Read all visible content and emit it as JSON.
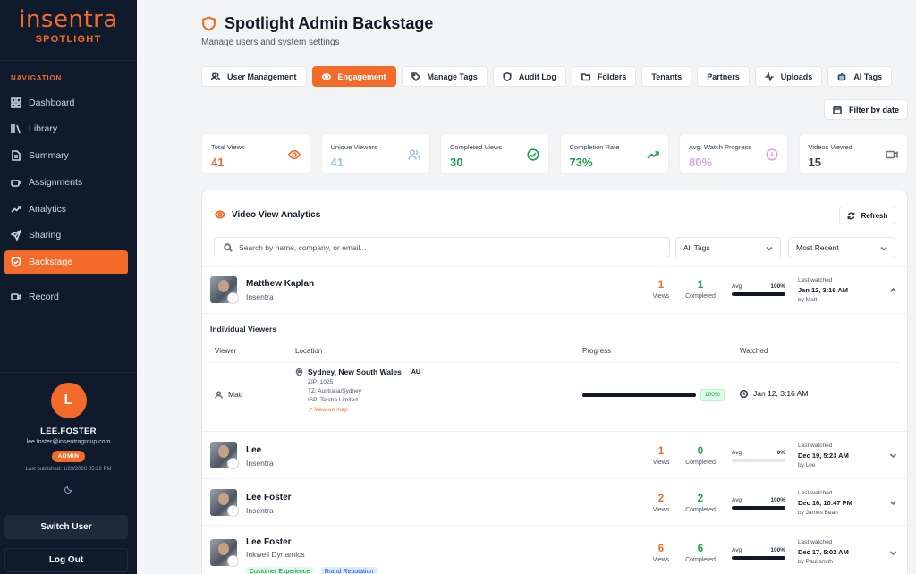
{
  "brand": {
    "name": "insentra",
    "product": "SPOTLIGHT"
  },
  "nav": {
    "label": "NAVIGATION",
    "items": [
      {
        "label": "Dashboard",
        "icon": "grid-icon"
      },
      {
        "label": "Library",
        "icon": "library-icon"
      },
      {
        "label": "Summary",
        "icon": "document-icon"
      },
      {
        "label": "Assignments",
        "icon": "coffee-icon"
      },
      {
        "label": "Analytics",
        "icon": "trend-icon"
      },
      {
        "label": "Sharing",
        "icon": "send-icon"
      },
      {
        "label": "Backstage",
        "icon": "shield-icon"
      },
      {
        "label": "Record",
        "icon": "video-icon"
      }
    ],
    "active": "Backstage"
  },
  "user": {
    "initial": "L",
    "name": "LEE.FOSTER",
    "email": "lee.foster@insentragroup.com",
    "role": "ADMIN",
    "last_published": "Last published: 1/29/2026 05:22 PM",
    "switch_label": "Switch User",
    "logout_label": "Log Out"
  },
  "header": {
    "title": "Spotlight Admin Backstage",
    "subtitle": "Manage users and system settings"
  },
  "tabs": [
    {
      "label": "User Management",
      "icon": "users-icon"
    },
    {
      "label": "Engagement",
      "icon": "eye-icon"
    },
    {
      "label": "Manage Tags",
      "icon": "tag-icon"
    },
    {
      "label": "Audit Log",
      "icon": "shield-icon"
    },
    {
      "label": "Folders",
      "icon": "folder-icon"
    },
    {
      "label": "Tenants",
      "icon": ""
    },
    {
      "label": "Partners",
      "icon": ""
    },
    {
      "label": "Uploads",
      "icon": "activity-icon"
    },
    {
      "label": "AI Tags",
      "icon": "robot-icon"
    }
  ],
  "active_tab": "Engagement",
  "filter_label": "Filter by date",
  "stats": [
    {
      "label": "Total Views",
      "value": "41",
      "color": "#f26b2a"
    },
    {
      "label": "Unique Viewers",
      "value": "41",
      "color": "#9cc3e0"
    },
    {
      "label": "Completed Views",
      "value": "30",
      "color": "#16a34a"
    },
    {
      "label": "Completion Rate",
      "value": "73%",
      "color": "#16a34a"
    },
    {
      "label": "Avg. Watch Progress",
      "value": "80%",
      "color": "#d8a6e8"
    },
    {
      "label": "Videos Viewed",
      "value": "15",
      "color": "#374151"
    }
  ],
  "panel": {
    "title": "Video View Analytics",
    "refresh_label": "Refresh",
    "search_placeholder": "Search by name, company, or email...",
    "tags_filter": "All Tags",
    "sort": "Most Recent",
    "views_label": "Views",
    "completed_label": "Completed",
    "avg_label": "Avg",
    "last_watched_label": "Last watched"
  },
  "rows": [
    {
      "name": "Matthew Kaplan",
      "company": "Insentra",
      "views": "1",
      "completed": "1",
      "avg": "100%",
      "avg_value": 100,
      "last_date": "Jan 12, 3:16 AM",
      "by": "by Matt",
      "expanded": true,
      "tags": []
    },
    {
      "name": "Lee",
      "company": "Insentra",
      "views": "1",
      "completed": "0",
      "avg": "0%",
      "avg_value": 0,
      "last_date": "Dec 19, 5:23 AM",
      "by": "by Lee",
      "expanded": false,
      "tags": []
    },
    {
      "name": "Lee Foster",
      "company": "Insentra",
      "views": "2",
      "completed": "2",
      "avg": "100%",
      "avg_value": 100,
      "last_date": "Dec 16, 10:47 PM",
      "by": "by James Bean",
      "expanded": false,
      "tags": []
    },
    {
      "name": "Lee Foster",
      "company": "Inkwell Dynamics",
      "views": "6",
      "completed": "6",
      "avg": "100%",
      "avg_value": 100,
      "last_date": "Dec 17, 5:02 AM",
      "by": "by Paul smith",
      "expanded": false,
      "tags": [
        "Customer Experience",
        "Brand Reputation"
      ]
    }
  ],
  "detail": {
    "title": "Individual Viewers",
    "headers": [
      "Viewer",
      "Location",
      "Progress",
      "Watched"
    ],
    "viewer": "Matt",
    "city": "Sydney, New South Wales",
    "country": "AU",
    "zip": "ZIP: 1025",
    "tz": "TZ: Australia/Sydney",
    "isp": "ISP: Telstra Limited",
    "map_link": "View on map",
    "progress": "100%",
    "progress_value": 100,
    "watched": "Jan 12, 3:16 AM"
  },
  "colors": {
    "accent": "#f26b2a",
    "sidebar": "#0f1b2d",
    "green": "#16a34a"
  }
}
